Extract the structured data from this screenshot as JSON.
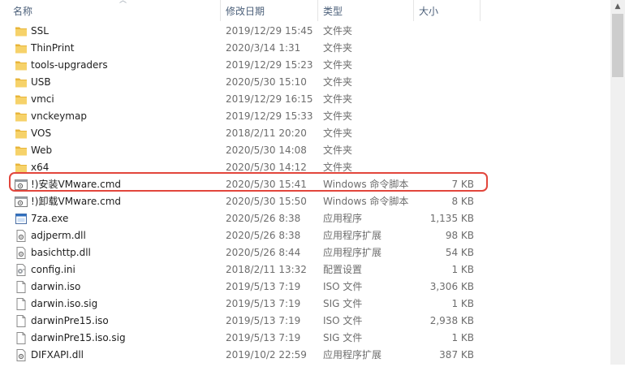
{
  "columns": {
    "name": "名称",
    "date": "修改日期",
    "type": "类型",
    "size": "大小"
  },
  "rows": [
    {
      "name": "SSL",
      "date": "2019/12/29 15:45",
      "type": "文件夹",
      "size": "",
      "icon": "folder-icon"
    },
    {
      "name": "ThinPrint",
      "date": "2020/3/14 1:31",
      "type": "文件夹",
      "size": "",
      "icon": "folder-icon"
    },
    {
      "name": "tools-upgraders",
      "date": "2019/12/29 15:23",
      "type": "文件夹",
      "size": "",
      "icon": "folder-icon"
    },
    {
      "name": "USB",
      "date": "2020/5/30 15:10",
      "type": "文件夹",
      "size": "",
      "icon": "folder-icon"
    },
    {
      "name": "vmci",
      "date": "2019/12/29 16:15",
      "type": "文件夹",
      "size": "",
      "icon": "folder-icon"
    },
    {
      "name": "vnckeymap",
      "date": "2019/12/29 15:33",
      "type": "文件夹",
      "size": "",
      "icon": "folder-icon"
    },
    {
      "name": "VOS",
      "date": "2018/2/11 20:20",
      "type": "文件夹",
      "size": "",
      "icon": "folder-icon"
    },
    {
      "name": "Web",
      "date": "2020/5/30 14:08",
      "type": "文件夹",
      "size": "",
      "icon": "folder-icon"
    },
    {
      "name": "x64",
      "date": "2020/5/30 14:12",
      "type": "文件夹",
      "size": "",
      "icon": "folder-icon"
    },
    {
      "name": "!)安装VMware.cmd",
      "date": "2020/5/30 15:41",
      "type": "Windows 命令脚本",
      "size": "7 KB",
      "icon": "cmd-script-icon"
    },
    {
      "name": "!)卸载VMware.cmd",
      "date": "2020/5/30 15:50",
      "type": "Windows 命令脚本",
      "size": "8 KB",
      "icon": "cmd-script-icon"
    },
    {
      "name": "7za.exe",
      "date": "2020/5/26 8:38",
      "type": "应用程序",
      "size": "1,135 KB",
      "icon": "exe-icon"
    },
    {
      "name": "adjperm.dll",
      "date": "2020/5/26 8:38",
      "type": "应用程序扩展",
      "size": "98 KB",
      "icon": "dll-icon"
    },
    {
      "name": "basichttp.dll",
      "date": "2020/5/26 8:44",
      "type": "应用程序扩展",
      "size": "54 KB",
      "icon": "dll-icon"
    },
    {
      "name": "config.ini",
      "date": "2018/2/11 13:32",
      "type": "配置设置",
      "size": "1 KB",
      "icon": "ini-icon"
    },
    {
      "name": "darwin.iso",
      "date": "2019/5/13 7:19",
      "type": "ISO 文件",
      "size": "3,306 KB",
      "icon": "file-icon"
    },
    {
      "name": "darwin.iso.sig",
      "date": "2019/5/13 7:19",
      "type": "SIG 文件",
      "size": "1 KB",
      "icon": "file-icon"
    },
    {
      "name": "darwinPre15.iso",
      "date": "2019/5/13 7:19",
      "type": "ISO 文件",
      "size": "2,938 KB",
      "icon": "file-icon"
    },
    {
      "name": "darwinPre15.iso.sig",
      "date": "2019/5/13 7:19",
      "type": "SIG 文件",
      "size": "1 KB",
      "icon": "file-icon"
    },
    {
      "name": "DIFXAPI.dll",
      "date": "2019/10/2 22:59",
      "type": "应用程序扩展",
      "size": "387 KB",
      "icon": "dll-icon"
    }
  ],
  "highlighted_row": "!)安装VMware.cmd",
  "colors": {
    "header_text": "#4c607a",
    "folder_yellow": "#f4c84e",
    "highlight_border": "#e2463c",
    "secondary_text": "#6d6d6d"
  }
}
